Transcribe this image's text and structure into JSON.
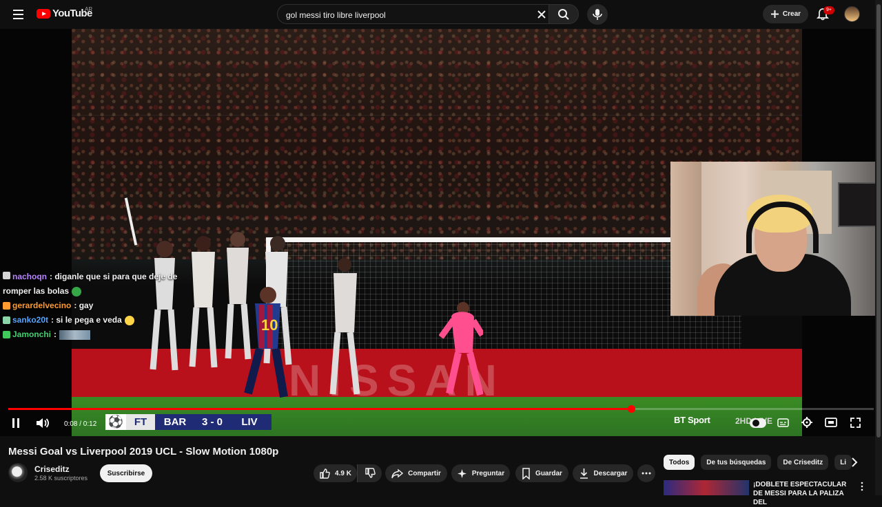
{
  "header": {
    "logo_text": "YouTube",
    "country": "AR",
    "search_value": "gol messi tiro libre liverpool",
    "create_label": "Crear",
    "notifications_badge": "9+"
  },
  "video": {
    "title": "Messi Goal vs Liverpool 2019 UCL - Slow Motion 1080p",
    "time": "0:08 / 0:12",
    "progress": 0.72,
    "ad_text": "NISSAN",
    "scoreboard": {
      "period": "FT",
      "home": "BAR",
      "score": "3 - 0",
      "away": "LIV"
    },
    "broadcaster": "BT Sport",
    "hd_live": "2HD LIVE"
  },
  "chat": [
    {
      "user": "nachoqn",
      "message": ": diganle que si para que deje de romper las bolas",
      "user_color": "#b785ff",
      "badge_color": "#d6d6d6"
    },
    {
      "user": "gerardelvecino",
      "message": ": gay",
      "user_color": "#ff9b2f",
      "badge_color": "#ff9b2f"
    },
    {
      "user": "sanko20t",
      "message": ": si le pega e veda",
      "user_color": "#57a5ff",
      "badge_color": "#8bd5a8"
    },
    {
      "user": "Jamonchi",
      "message": ":",
      "user_color": "#42d16f",
      "badge_color": "#41c85c"
    }
  ],
  "channel": {
    "name": "Criseditz",
    "subscribers": "2.58 K suscriptores",
    "subscribe_label": "Suscribirse"
  },
  "actions": {
    "likes": "4.9 K",
    "share": "Compartir",
    "ask": "Preguntar",
    "save": "Guardar",
    "download": "Descargar"
  },
  "filters": [
    "Todos",
    "De tus búsquedas",
    "De Criseditz",
    "Li"
  ],
  "recommendation": {
    "title": "¡DOBLETE ESPECTACULAR DE MESSI PARA LA PALIZA DEL"
  },
  "colors": {
    "accent": "#ff0000",
    "background": "#0f0f0f",
    "chip": "#272727"
  },
  "icons": [
    "menu-icon",
    "search-icon",
    "clear-icon",
    "mic-icon",
    "plus-icon",
    "bell-icon",
    "pause-icon",
    "volume-icon",
    "captions-icon",
    "settings-icon",
    "theater-icon",
    "fullscreen-icon",
    "like-icon",
    "dislike-icon",
    "share-icon",
    "ask-icon",
    "save-icon",
    "download-icon",
    "more-icon",
    "chevron-right-icon"
  ]
}
